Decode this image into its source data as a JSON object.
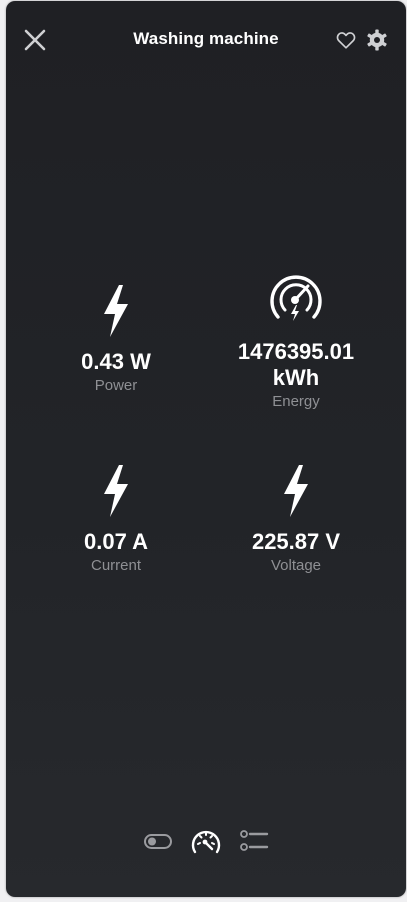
{
  "header": {
    "title": "Washing machine",
    "close_icon": "close-icon",
    "favorite_icon": "heart-outline-icon",
    "settings_icon": "gear-icon"
  },
  "metrics": [
    {
      "id": "power",
      "value": "0.43 W",
      "label": "Power",
      "icon": "lightning-icon"
    },
    {
      "id": "energy",
      "value": "1476395.01 kWh",
      "label": "Energy",
      "icon": "gauge-lightning-icon"
    },
    {
      "id": "current",
      "value": "0.07 A",
      "label": "Current",
      "icon": "lightning-icon"
    },
    {
      "id": "voltage",
      "value": "225.87 V",
      "label": "Voltage",
      "icon": "lightning-icon"
    }
  ],
  "bottom_nav": {
    "items": [
      {
        "id": "controls",
        "icon": "toggle-icon",
        "active": false
      },
      {
        "id": "sensors",
        "icon": "gauge-icon",
        "active": true
      },
      {
        "id": "list",
        "icon": "list-icon",
        "active": false
      }
    ]
  },
  "colors": {
    "panel_background": "#1f2024",
    "text_primary": "#ffffff",
    "text_secondary": "#8f9094",
    "icon_inactive": "#9a9b9f"
  }
}
